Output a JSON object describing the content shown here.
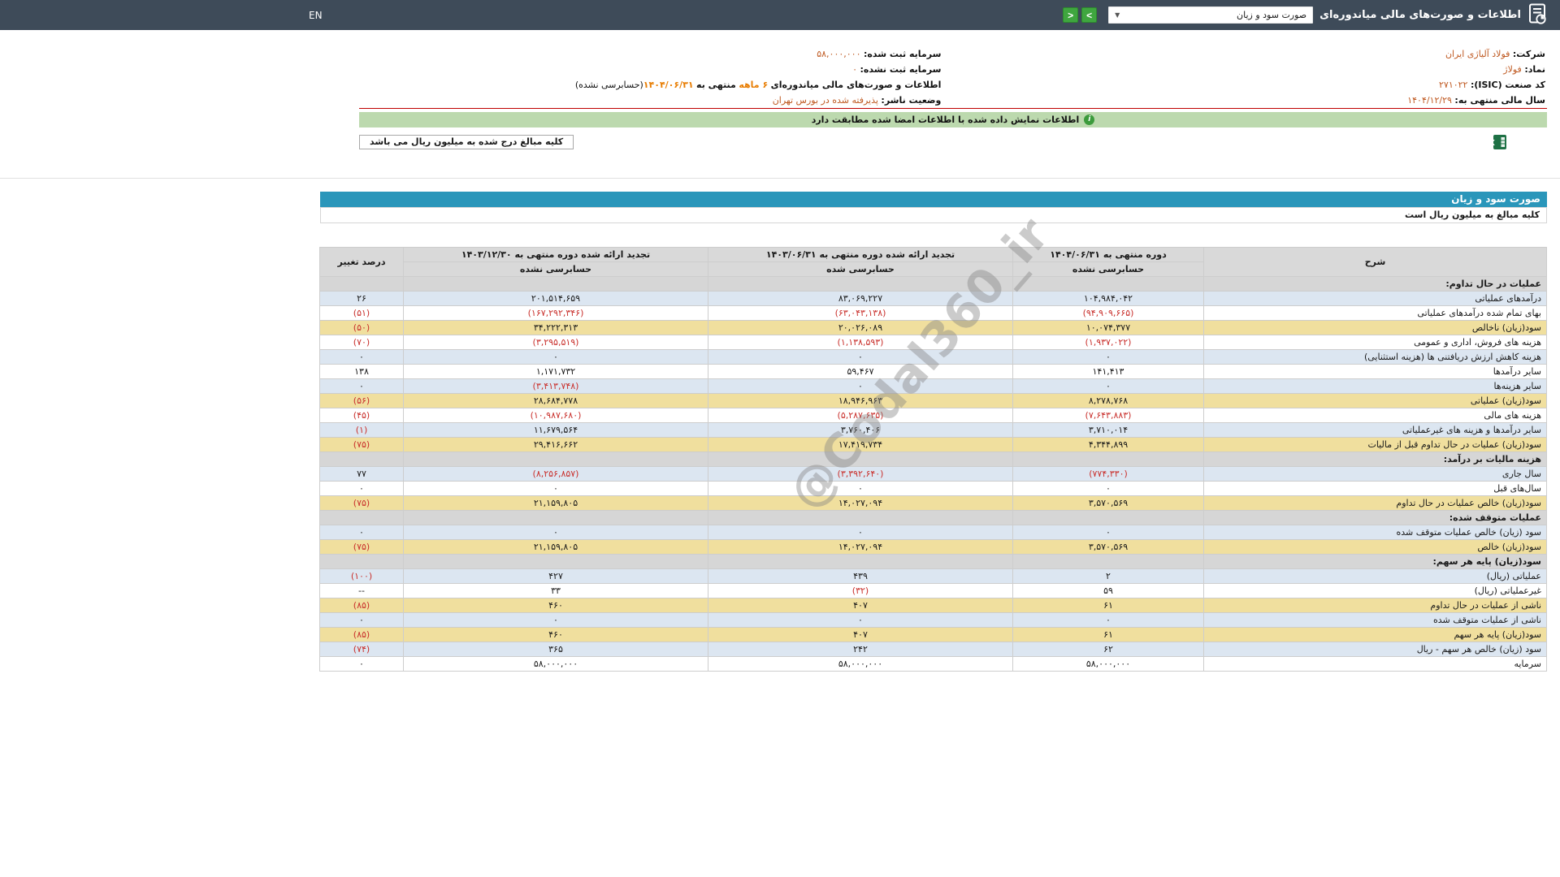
{
  "header": {
    "title": "اطلاعات و صورت‌های مالی میاندوره‌ای",
    "report_select": {
      "value": "صورت سود و زیان"
    },
    "next_label": ">",
    "prev_label": "<",
    "en_label": "EN"
  },
  "company_info": {
    "rows": [
      {
        "right": {
          "label": "شرکت:",
          "value": "فولاد آلیاژی ایران"
        },
        "left": {
          "label": "سرمایه ثبت شده:",
          "value": "۵۸,۰۰۰,۰۰۰"
        }
      },
      {
        "right": {
          "label": "نماد:",
          "value": "فولاژ"
        },
        "left": {
          "label": "سرمایه ثبت نشده:",
          "value": "۰"
        }
      },
      {
        "right": {
          "label": "کد صنعت (ISIC):",
          "value": "۲۷۱۰۲۲"
        },
        "left": {
          "label": "اطلاعات و صورت‌های مالی میاندوره‌ای",
          "duration": "۶ ماهه",
          "middle": "منتهی به",
          "date": "۱۴۰۴/۰۶/۳۱",
          "suffix": "(حسابرسی نشده)"
        }
      },
      {
        "right": {
          "label": "سال مالی منتهی به:",
          "value": "۱۴۰۴/۱۲/۲۹"
        },
        "left": {
          "label": "وضعیت ناشر:",
          "value": "پذیرفته شده در بورس تهران"
        }
      }
    ]
  },
  "banner": {
    "text": "اطلاعات نمایش داده شده با اطلاعات امضا شده مطابقت دارد"
  },
  "note": {
    "text": "کلیه مبالغ درج شده به میلیون ریال می باشد"
  },
  "statement": {
    "title": "صورت سود و زیان",
    "subtitle": "کلیه مبالغ به میلیون ریال است",
    "header": {
      "desc": "شرح",
      "change": "درصد تغییر",
      "cols": [
        {
          "period": "دوره منتهی به ۱۴۰۴/۰۶/۳۱",
          "audit": "حسابرسی نشده"
        },
        {
          "period": "تجدید ارائه شده دوره منتهی به ۱۴۰۳/۰۶/۳۱",
          "audit": "حسابرسی شده"
        },
        {
          "period": "تجدید ارائه شده دوره منتهی به ۱۴۰۳/۱۲/۳۰",
          "audit": "حسابرسی نشده"
        }
      ]
    },
    "rows": [
      {
        "type": "section",
        "label": "عملیات در حال تداوم:"
      },
      {
        "type": "data",
        "bg": "blue",
        "label": "درآمدهای عملیاتی",
        "v": [
          "۱۰۴,۹۸۴,۰۴۲",
          "۸۳,۰۶۹,۲۲۷",
          "۲۰۱,۵۱۴,۶۵۹"
        ],
        "chg": "۲۶"
      },
      {
        "type": "data",
        "bg": "white",
        "label": "بهای تمام شده درآمدهای عملیاتی",
        "v": [
          "(۹۴,۹۰۹,۶۶۵)",
          "(۶۳,۰۴۳,۱۳۸)",
          "(۱۶۷,۲۹۲,۳۴۶)"
        ],
        "chg": "(۵۱)"
      },
      {
        "type": "data",
        "bg": "yellow",
        "label": "سود(زیان) ناخالص",
        "v": [
          "۱۰,۰۷۴,۳۷۷",
          "۲۰,۰۲۶,۰۸۹",
          "۳۴,۲۲۲,۳۱۳"
        ],
        "chg": "(۵۰)"
      },
      {
        "type": "data",
        "bg": "white",
        "label": "هزینه های فروش، اداری و عمومی",
        "v": [
          "(۱,۹۳۷,۰۲۲)",
          "(۱,۱۳۸,۵۹۳)",
          "(۳,۲۹۵,۵۱۹)"
        ],
        "chg": "(۷۰)"
      },
      {
        "type": "data",
        "bg": "blue",
        "label": "هزینه کاهش ارزش دریافتنی ها (هزینه استثنایی)",
        "v": [
          "۰",
          "۰",
          "۰"
        ],
        "chg": "۰"
      },
      {
        "type": "data",
        "bg": "white",
        "label": "سایر درآمدها",
        "v": [
          "۱۴۱,۴۱۳",
          "۵۹,۴۶۷",
          "۱,۱۷۱,۷۳۲"
        ],
        "chg": "۱۳۸"
      },
      {
        "type": "data",
        "bg": "blue",
        "label": "سایر هزینه‌ها",
        "v": [
          "۰",
          "۰",
          "(۳,۴۱۳,۷۴۸)"
        ],
        "chg": "۰"
      },
      {
        "type": "data",
        "bg": "yellow",
        "label": "سود(زیان) عملیاتی",
        "v": [
          "۸,۲۷۸,۷۶۸",
          "۱۸,۹۴۶,۹۶۳",
          "۲۸,۶۸۴,۷۷۸"
        ],
        "chg": "(۵۶)"
      },
      {
        "type": "data",
        "bg": "white",
        "label": "هزینه های مالی",
        "v": [
          "(۷,۶۴۳,۸۸۳)",
          "(۵,۲۸۷,۶۳۵)",
          "(۱۰,۹۸۷,۶۸۰)"
        ],
        "chg": "(۴۵)"
      },
      {
        "type": "data",
        "bg": "blue",
        "label": "سایر درآمدها و هزینه های غیرعملیاتی",
        "v": [
          "۳,۷۱۰,۰۱۴",
          "۳,۷۶۰,۴۰۶",
          "۱۱,۶۷۹,۵۶۴"
        ],
        "chg": "(۱)"
      },
      {
        "type": "data",
        "bg": "yellow",
        "label": "سود(زیان) عملیات در حال تداوم قبل از مالیات",
        "v": [
          "۴,۳۴۴,۸۹۹",
          "۱۷,۴۱۹,۷۳۴",
          "۲۹,۴۱۶,۶۶۲"
        ],
        "chg": "(۷۵)"
      },
      {
        "type": "section",
        "label": "هزینه مالیات بر درآمد:"
      },
      {
        "type": "data",
        "bg": "blue",
        "label": "سال جاری",
        "v": [
          "(۷۷۴,۳۳۰)",
          "(۳,۳۹۲,۶۴۰)",
          "(۸,۲۵۶,۸۵۷)"
        ],
        "chg": "۷۷"
      },
      {
        "type": "data",
        "bg": "white",
        "label": "سال‌های قبل",
        "v": [
          "۰",
          "۰",
          "۰"
        ],
        "chg": "۰"
      },
      {
        "type": "data",
        "bg": "yellow",
        "label": "سود(زیان) خالص عملیات در حال تداوم",
        "v": [
          "۳,۵۷۰,۵۶۹",
          "۱۴,۰۲۷,۰۹۴",
          "۲۱,۱۵۹,۸۰۵"
        ],
        "chg": "(۷۵)"
      },
      {
        "type": "section",
        "label": "عملیات متوقف شده:"
      },
      {
        "type": "data",
        "bg": "blue",
        "label": "سود (زیان) خالص عملیات متوقف شده",
        "v": [
          "۰",
          "۰",
          "۰"
        ],
        "chg": "۰"
      },
      {
        "type": "data",
        "bg": "yellow",
        "label": "سود(زیان) خالص",
        "v": [
          "۳,۵۷۰,۵۶۹",
          "۱۴,۰۲۷,۰۹۴",
          "۲۱,۱۵۹,۸۰۵"
        ],
        "chg": "(۷۵)"
      },
      {
        "type": "section",
        "label": "سود(زیان) پایه هر سهم:"
      },
      {
        "type": "data",
        "bg": "blue",
        "label": "عملیاتی (ریال)",
        "v": [
          "۲",
          "۴۳۹",
          "۴۲۷"
        ],
        "chg": "(۱۰۰)"
      },
      {
        "type": "data",
        "bg": "white",
        "label": "غیرعملیاتی (ریال)",
        "v": [
          "۵۹",
          "(۳۲)",
          "۳۳"
        ],
        "chg": "--"
      },
      {
        "type": "data",
        "bg": "yellow",
        "label": "ناشی از عملیات در حال تداوم",
        "v": [
          "۶۱",
          "۴۰۷",
          "۴۶۰"
        ],
        "chg": "(۸۵)"
      },
      {
        "type": "data",
        "bg": "blue",
        "label": "ناشی از عملیات متوقف شده",
        "v": [
          "۰",
          "۰",
          "۰"
        ],
        "chg": "۰"
      },
      {
        "type": "data",
        "bg": "yellow",
        "label": "سود(زیان) پایه هر سهم",
        "v": [
          "۶۱",
          "۴۰۷",
          "۴۶۰"
        ],
        "chg": "(۸۵)"
      },
      {
        "type": "data",
        "bg": "blue",
        "label": "سود (زیان) خالص هر سهم - ریال",
        "v": [
          "۶۲",
          "۲۴۲",
          "۳۶۵"
        ],
        "chg": "(۷۴)"
      },
      {
        "type": "data",
        "bg": "white",
        "label": "سرمایه",
        "v": [
          "۵۸,۰۰۰,۰۰۰",
          "۵۸,۰۰۰,۰۰۰",
          "۵۸,۰۰۰,۰۰۰"
        ],
        "chg": "۰"
      }
    ]
  },
  "watermark": {
    "text": "@Codal360_ir"
  },
  "colors": {
    "topbar": "#3e4b59",
    "accent_teal": "#2a96ba",
    "nav_green": "#3fa63f",
    "banner_green": "#bcd9ae",
    "row_yellow": "#f0df9e",
    "row_blue": "#dce6f1",
    "negative_red": "#c9302c",
    "info_value_orange": "#bf5921",
    "info_highlight_orange": "#e87e04",
    "divider_red": "#c00000"
  }
}
